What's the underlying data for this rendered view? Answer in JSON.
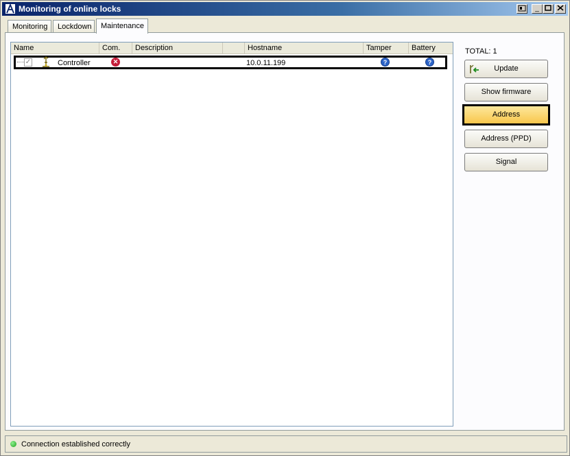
{
  "window": {
    "title": "Monitoring of online locks"
  },
  "tabs": [
    {
      "label": "Monitoring"
    },
    {
      "label": "Lockdown"
    },
    {
      "label": "Maintenance"
    }
  ],
  "grid": {
    "columns": [
      "Name",
      "Com.",
      "Description",
      "",
      "Hostname",
      "Tamper",
      "Battery"
    ],
    "rows": [
      {
        "checked": true,
        "name": "Controller",
        "com_status": "error",
        "description": "",
        "hostname": "10.0.11.199",
        "tamper_status": "unknown",
        "battery_status": "unknown"
      }
    ]
  },
  "side": {
    "total": "TOTAL: 1",
    "buttons": {
      "update": "Update",
      "show_firmware": "Show firmware",
      "address": "Address",
      "address_ppd": "Address (PPD)",
      "signal": "Signal"
    }
  },
  "status": {
    "text": "Connection established correctly",
    "color": "#1fa31f"
  },
  "colors": {
    "highlight": "#f8c64c",
    "error": "#c41e3a",
    "info": "#2c64c8"
  }
}
